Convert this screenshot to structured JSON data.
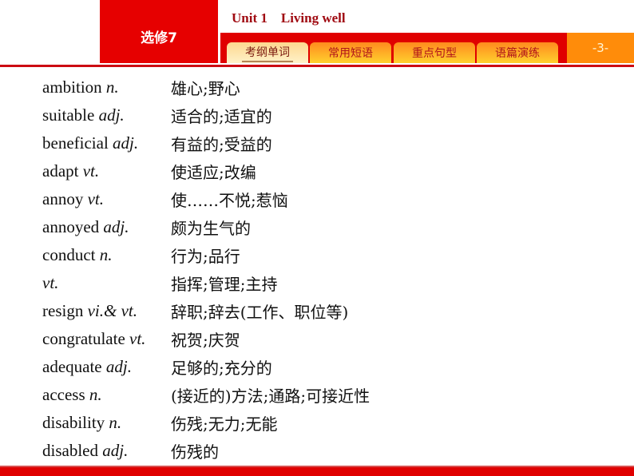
{
  "header": {
    "course": "选修7",
    "unit_title": "Unit 1    Living well",
    "page_number": "-3-",
    "tabs": [
      {
        "label": "考纲单词",
        "active": true
      },
      {
        "label": "常用短语",
        "active": false
      },
      {
        "label": "重点句型",
        "active": false
      },
      {
        "label": "语篇演练",
        "active": false
      }
    ]
  },
  "colors": {
    "brand_red": "#e60000",
    "title_dark_red": "#a00b12",
    "page_orange": "#ff8c0a"
  },
  "vocabulary": [
    {
      "word": "ambition ",
      "pos": "n.",
      "meaning": "雄心;野心"
    },
    {
      "word": "suitable ",
      "pos": "adj.",
      "meaning": "适合的;适宜的"
    },
    {
      "word": "beneficial ",
      "pos": "adj.",
      "meaning": "有益的;受益的"
    },
    {
      "word": "adapt ",
      "pos": "vt.",
      "meaning": "使适应;改编"
    },
    {
      "word": "annoy ",
      "pos": "vt.",
      "meaning": "使……不悦;惹恼"
    },
    {
      "word": "annoyed ",
      "pos": "adj.",
      "meaning": "颇为生气的"
    },
    {
      "word": "conduct ",
      "pos": "n.",
      "meaning": "行为;品行"
    },
    {
      "word": "",
      "pos": "vt.",
      "meaning": "指挥;管理;主持"
    },
    {
      "word": "resign ",
      "pos": "vi.& vt.",
      "meaning": "辞职;辞去(工作、职位等)"
    },
    {
      "word": "congratulate ",
      "pos": "vt.",
      "meaning": "祝贺;庆贺"
    },
    {
      "word": "adequate ",
      "pos": "adj.",
      "meaning": "足够的;充分的"
    },
    {
      "word": "access ",
      "pos": "n.",
      "meaning": "(接近的)方法;通路;可接近性"
    },
    {
      "word": "disability ",
      "pos": "n.",
      "meaning": "伤残;无力;无能"
    },
    {
      "word": "disabled ",
      "pos": "adj.",
      "meaning": "伤残的"
    }
  ]
}
